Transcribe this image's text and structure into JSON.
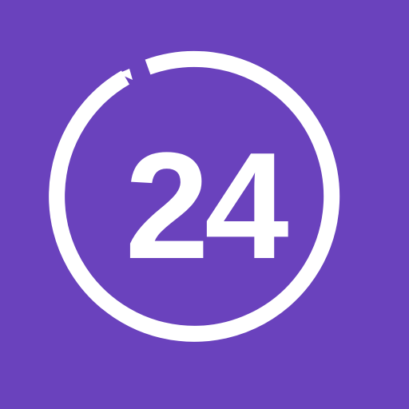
{
  "icon": {
    "number": "24",
    "background_color": "#6a42bd",
    "foreground_color": "#ffffff",
    "ring_icon": "circular-arrow-icon"
  }
}
